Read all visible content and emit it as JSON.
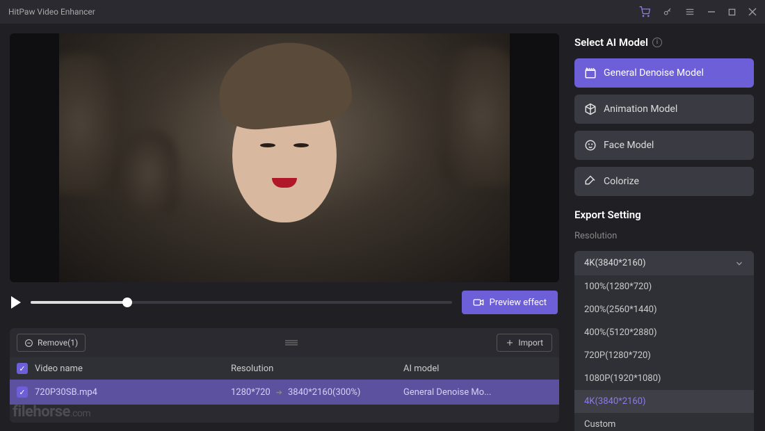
{
  "titlebar": {
    "app_name": "HitPaw Video Enhancer"
  },
  "controls": {
    "preview_label": "Preview effect"
  },
  "queue": {
    "remove_label": "Remove(1)",
    "import_label": "Import",
    "header": {
      "name": "Video name",
      "resolution": "Resolution",
      "model": "AI model"
    },
    "row": {
      "name": "720P30SB.mp4",
      "res_from": "1280*720",
      "res_to": "3840*2160(300%)",
      "model": "General Denoise Mo..."
    }
  },
  "sidebar": {
    "title": "Select AI Model",
    "models": {
      "general": "General Denoise Model",
      "animation": "Animation Model",
      "face": "Face Model",
      "colorize": "Colorize"
    },
    "export_title": "Export Setting",
    "resolution_label": "Resolution",
    "resolution_selected": "4K(3840*2160)",
    "options": {
      "o1": "100%(1280*720)",
      "o2": "200%(2560*1440)",
      "o3": "400%(5120*2880)",
      "o4": "720P(1280*720)",
      "o5": "1080P(1920*1080)",
      "o6": "4K(3840*2160)",
      "o7": "Custom"
    }
  },
  "watermark": {
    "main": "filehorse",
    "suffix": ".com"
  }
}
